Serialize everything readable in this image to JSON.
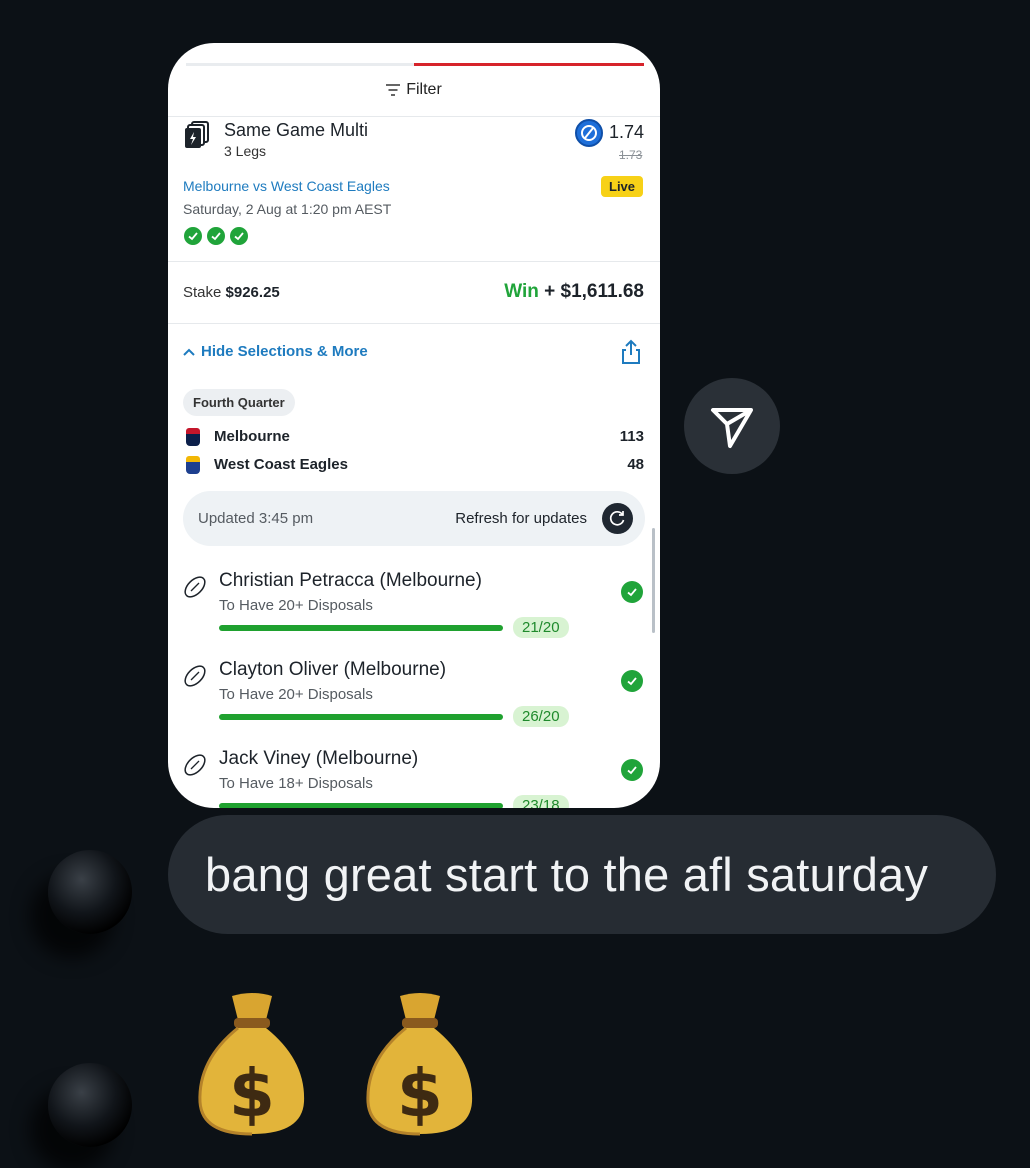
{
  "card": {
    "filter_label": "Filter",
    "bet_type": "Same Game Multi",
    "legs_count": "3 Legs",
    "odds": "1.74",
    "old_odds": "1.73",
    "match": "Melbourne vs West Coast Eagles",
    "status_badge": "Live",
    "date": "Saturday, 2 Aug at 1:20 pm AEST",
    "stake_label": "Stake",
    "stake_value": "$926.25",
    "win_label": "Win",
    "win_value": "+ $1,611.68",
    "hide_selections": "Hide Selections & More",
    "quarter": "Fourth Quarter",
    "teams": [
      {
        "name": "Melbourne",
        "score": "113",
        "color": "#c4162b"
      },
      {
        "name": "West Coast Eagles",
        "score": "48",
        "color": "#1d3f8f"
      }
    ],
    "updated": "Updated 3:45 pm",
    "refresh_label": "Refresh for updates",
    "legs": [
      {
        "player": "Christian Petracca (Melbourne)",
        "market": "To Have 20+ Disposals",
        "progress": "21/20",
        "fill": 1.0
      },
      {
        "player": "Clayton Oliver (Melbourne)",
        "market": "To Have 20+ Disposals",
        "progress": "26/20",
        "fill": 1.0
      },
      {
        "player": "Jack Viney (Melbourne)",
        "market": "To Have 18+ Disposals",
        "progress": "23/18",
        "fill": 1.0
      }
    ]
  },
  "message": {
    "text": "bang great start to the afl saturday",
    "reaction": "💰 💰"
  },
  "colors": {
    "background": "#0c1116",
    "bubble": "#262c33",
    "accent_green": "#20a43a",
    "link_blue": "#1e7bbf",
    "live_yellow": "#f7d117"
  }
}
